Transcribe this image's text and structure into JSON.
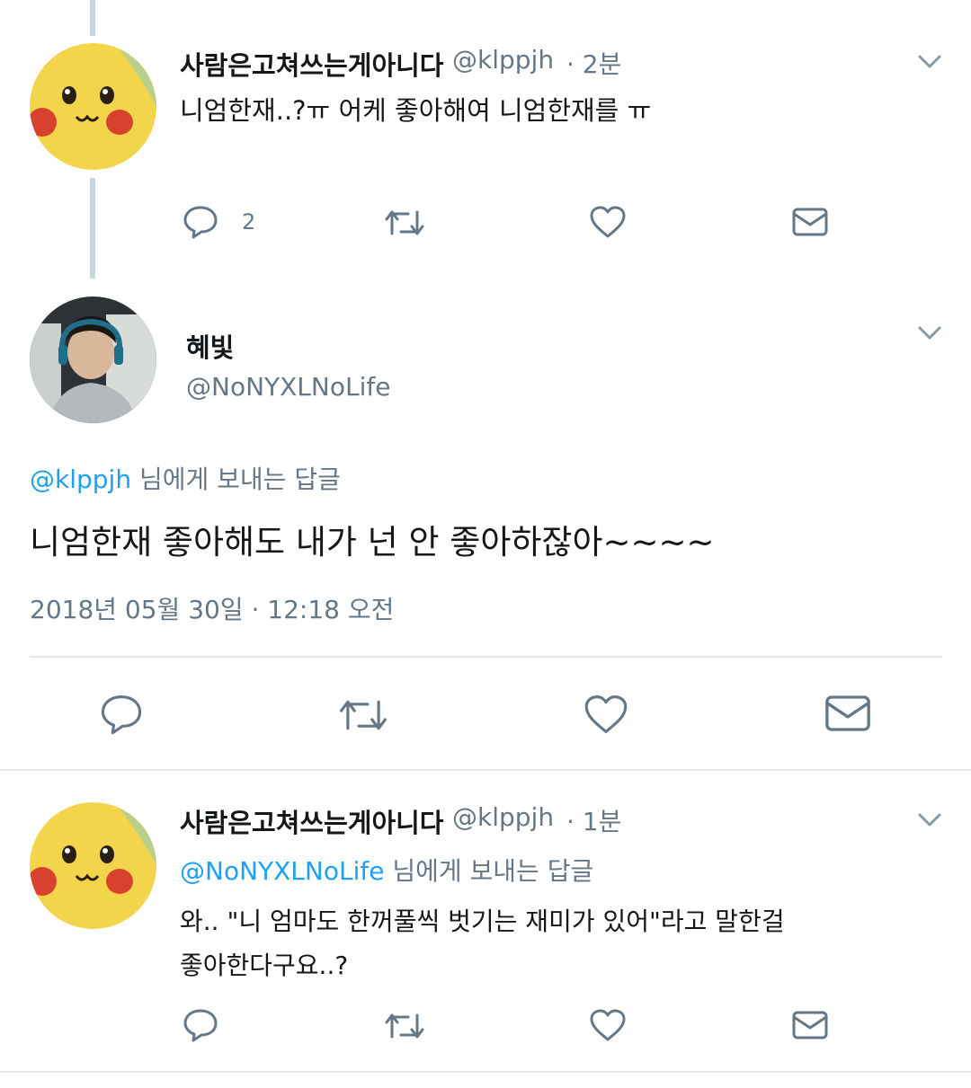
{
  "tweets": [
    {
      "display_name": "사람은고쳐쓰는게아니다",
      "handle": "@klppjh",
      "time": "· 2분",
      "text": "니엄한재..?ㅠ 어케 좋아해여 니엄한재를 ㅠ",
      "reply_count": "2",
      "avatar_icon": "pikachu-avatar"
    },
    {
      "display_name": "혜빛",
      "handle": "@NoNYXLNoLife",
      "reply_to_handle": "@klppjh",
      "reply_to_suffix": " 님에게 보내는 답글",
      "text": "니엄한재 좋아해도 내가 넌 안 좋아하잖아~~~~",
      "timestamp": "2018년 05월 30일 · 12:18 오전",
      "avatar_icon": "gamer-avatar"
    },
    {
      "display_name": "사람은고쳐쓰는게아니다",
      "handle": "@klppjh",
      "time": "· 1분",
      "reply_to_handle": "@NoNYXLNoLife",
      "reply_to_suffix": " 님에게 보내는 답글",
      "text_line1": "와.. \"니 엄마도 한꺼풀씩 벗기는 재미가 있어\"라고 말한걸",
      "text_line2": "좋아한다구요..?",
      "avatar_icon": "pikachu-avatar"
    }
  ],
  "icons": {
    "reply": "reply-icon",
    "retweet": "retweet-icon",
    "like": "like-icon",
    "dm": "message-icon",
    "caret": "chevron-down-icon"
  },
  "colors": {
    "link": "#1da1f2",
    "muted": "#657786",
    "icon": "#657786",
    "divider": "#e1e8ed",
    "thread": "#ccd6dd"
  }
}
